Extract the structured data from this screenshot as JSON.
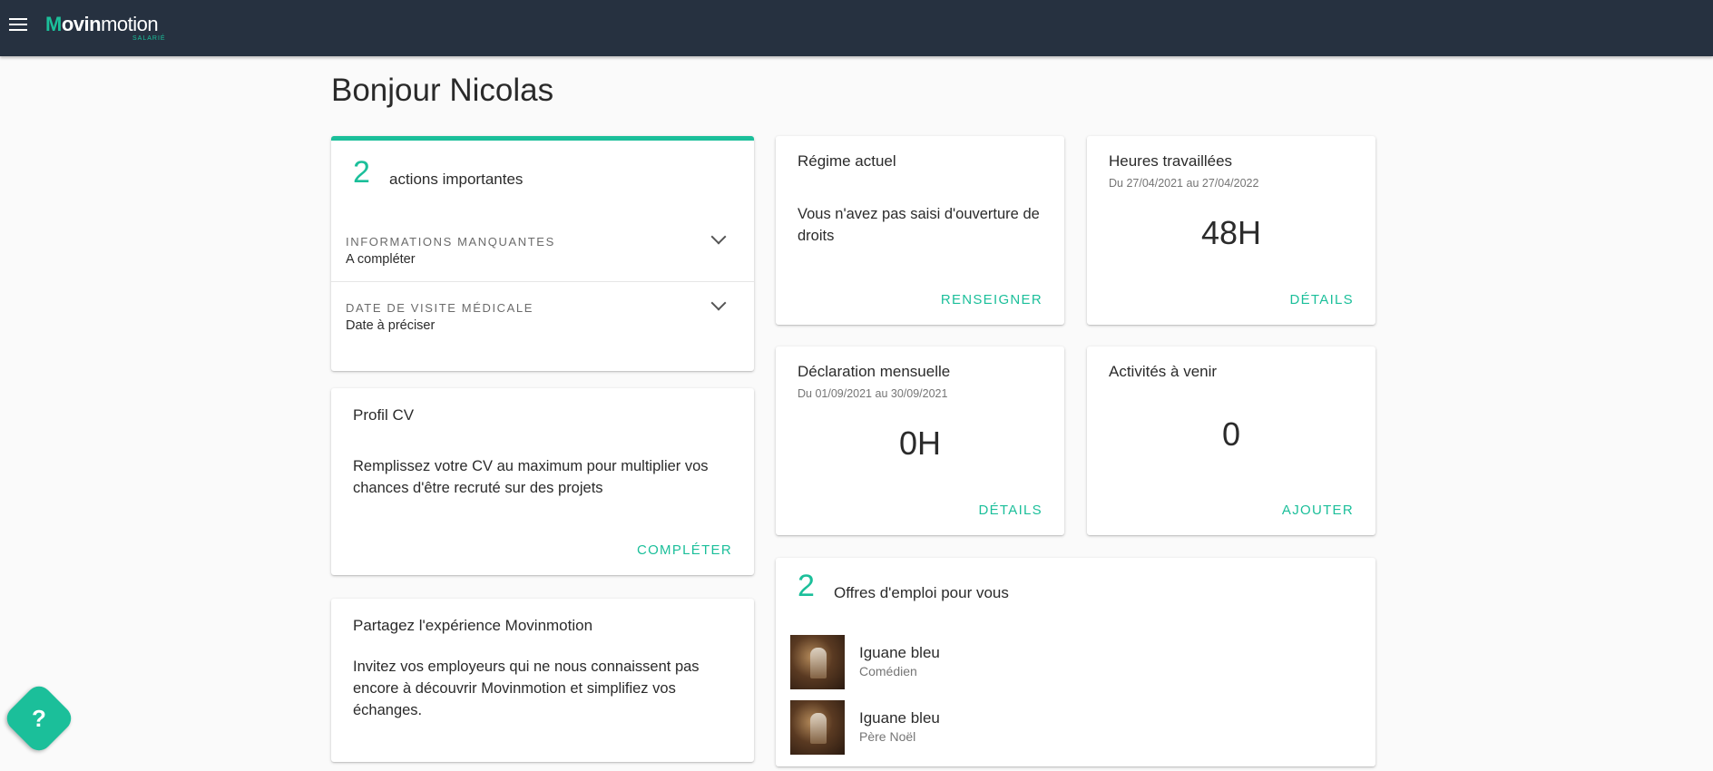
{
  "app": {
    "logo_word_start": "M",
    "logo_word_bold": "ovin",
    "logo_word_end": "motion",
    "logo_sub": "SALARIÉ"
  },
  "greeting": "Bonjour Nicolas",
  "actions_card": {
    "count": "2",
    "label": "actions importantes",
    "items": [
      {
        "label": "INFORMATIONS MANQUANTES",
        "value": "A compléter"
      },
      {
        "label": "DATE DE VISITE MÉDICALE",
        "value": "Date à préciser"
      }
    ],
    "accent_color": "#1bbf9a"
  },
  "profil_cv": {
    "title": "Profil CV",
    "text": "Remplissez votre CV au maximum pour multiplier vos chances d'être recruté sur des projets",
    "action": "COMPLÉTER"
  },
  "partage": {
    "title": "Partagez l'expérience Movinmotion",
    "text": "Invitez vos employeurs qui ne nous connaissent pas encore à découvrir Movinmotion et simplifiez vos échanges."
  },
  "regime": {
    "title": "Régime actuel",
    "text": "Vous n'avez pas saisi d'ouverture de droits",
    "action": "RENSEIGNER"
  },
  "heures": {
    "title": "Heures travaillées",
    "period": "Du 27/04/2021 au 27/04/2022",
    "value": "48H",
    "action": "DÉTAILS"
  },
  "declaration": {
    "title": "Déclaration mensuelle",
    "period": "Du 01/09/2021 au 30/09/2021",
    "value": "0H",
    "action": "DÉTAILS"
  },
  "activites": {
    "title": "Activités à venir",
    "value": "0",
    "action": "AJOUTER"
  },
  "offres": {
    "count": "2",
    "label": "Offres d'emploi pour vous",
    "jobs": [
      {
        "title": "Iguane bleu",
        "role": "Comédien"
      },
      {
        "title": "Iguane bleu",
        "role": "Père Noël"
      }
    ]
  },
  "help_label": "?"
}
